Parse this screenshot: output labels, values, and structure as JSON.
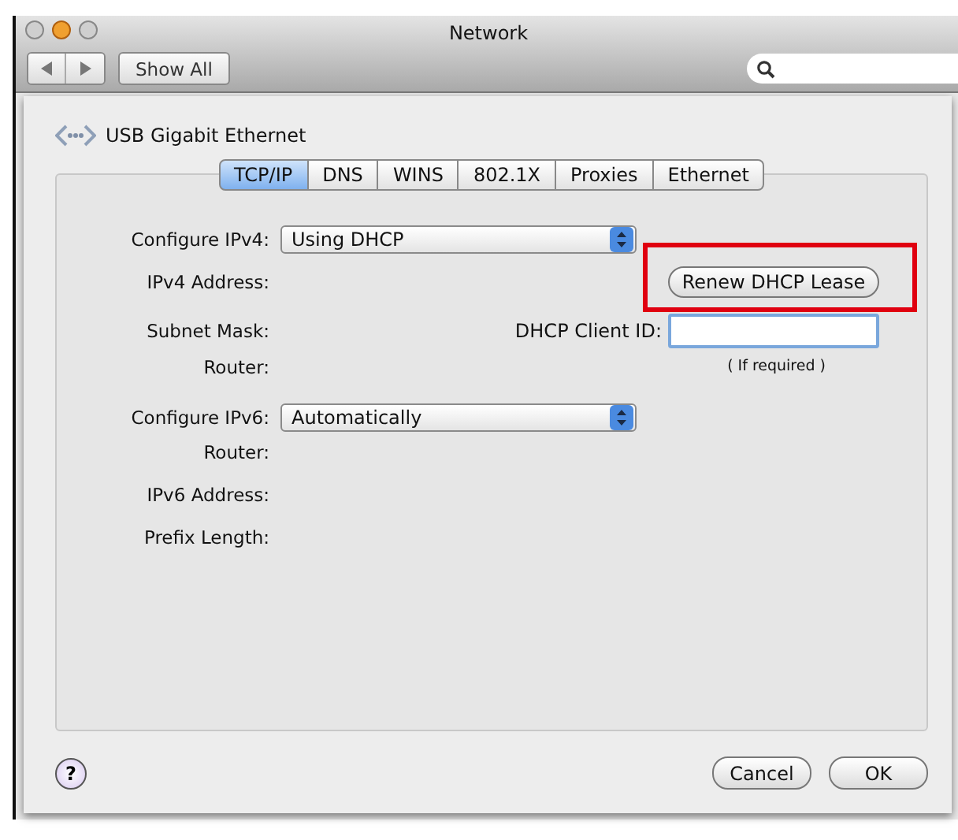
{
  "window": {
    "title": "Network"
  },
  "toolbar": {
    "show_all": "Show All"
  },
  "interface": {
    "name": "USB Gigabit Ethernet"
  },
  "tabs": [
    {
      "label": "TCP/IP",
      "selected": true
    },
    {
      "label": "DNS",
      "selected": false
    },
    {
      "label": "WINS",
      "selected": false
    },
    {
      "label": "802.1X",
      "selected": false
    },
    {
      "label": "Proxies",
      "selected": false
    },
    {
      "label": "Ethernet",
      "selected": false
    }
  ],
  "ipv4": {
    "configure_label": "Configure IPv4:",
    "configure_value": "Using DHCP",
    "address_label": "IPv4 Address:",
    "subnet_label": "Subnet Mask:",
    "router_label": "Router:",
    "renew_button": "Renew DHCP Lease",
    "client_id_label": "DHCP Client ID:",
    "client_id_hint": "( If required )"
  },
  "ipv6": {
    "configure_label": "Configure IPv6:",
    "configure_value": "Automatically",
    "router_label": "Router:",
    "address_label": "IPv6 Address:",
    "prefix_label": "Prefix Length:"
  },
  "buttons": {
    "help": "?",
    "cancel": "Cancel",
    "ok": "OK"
  }
}
